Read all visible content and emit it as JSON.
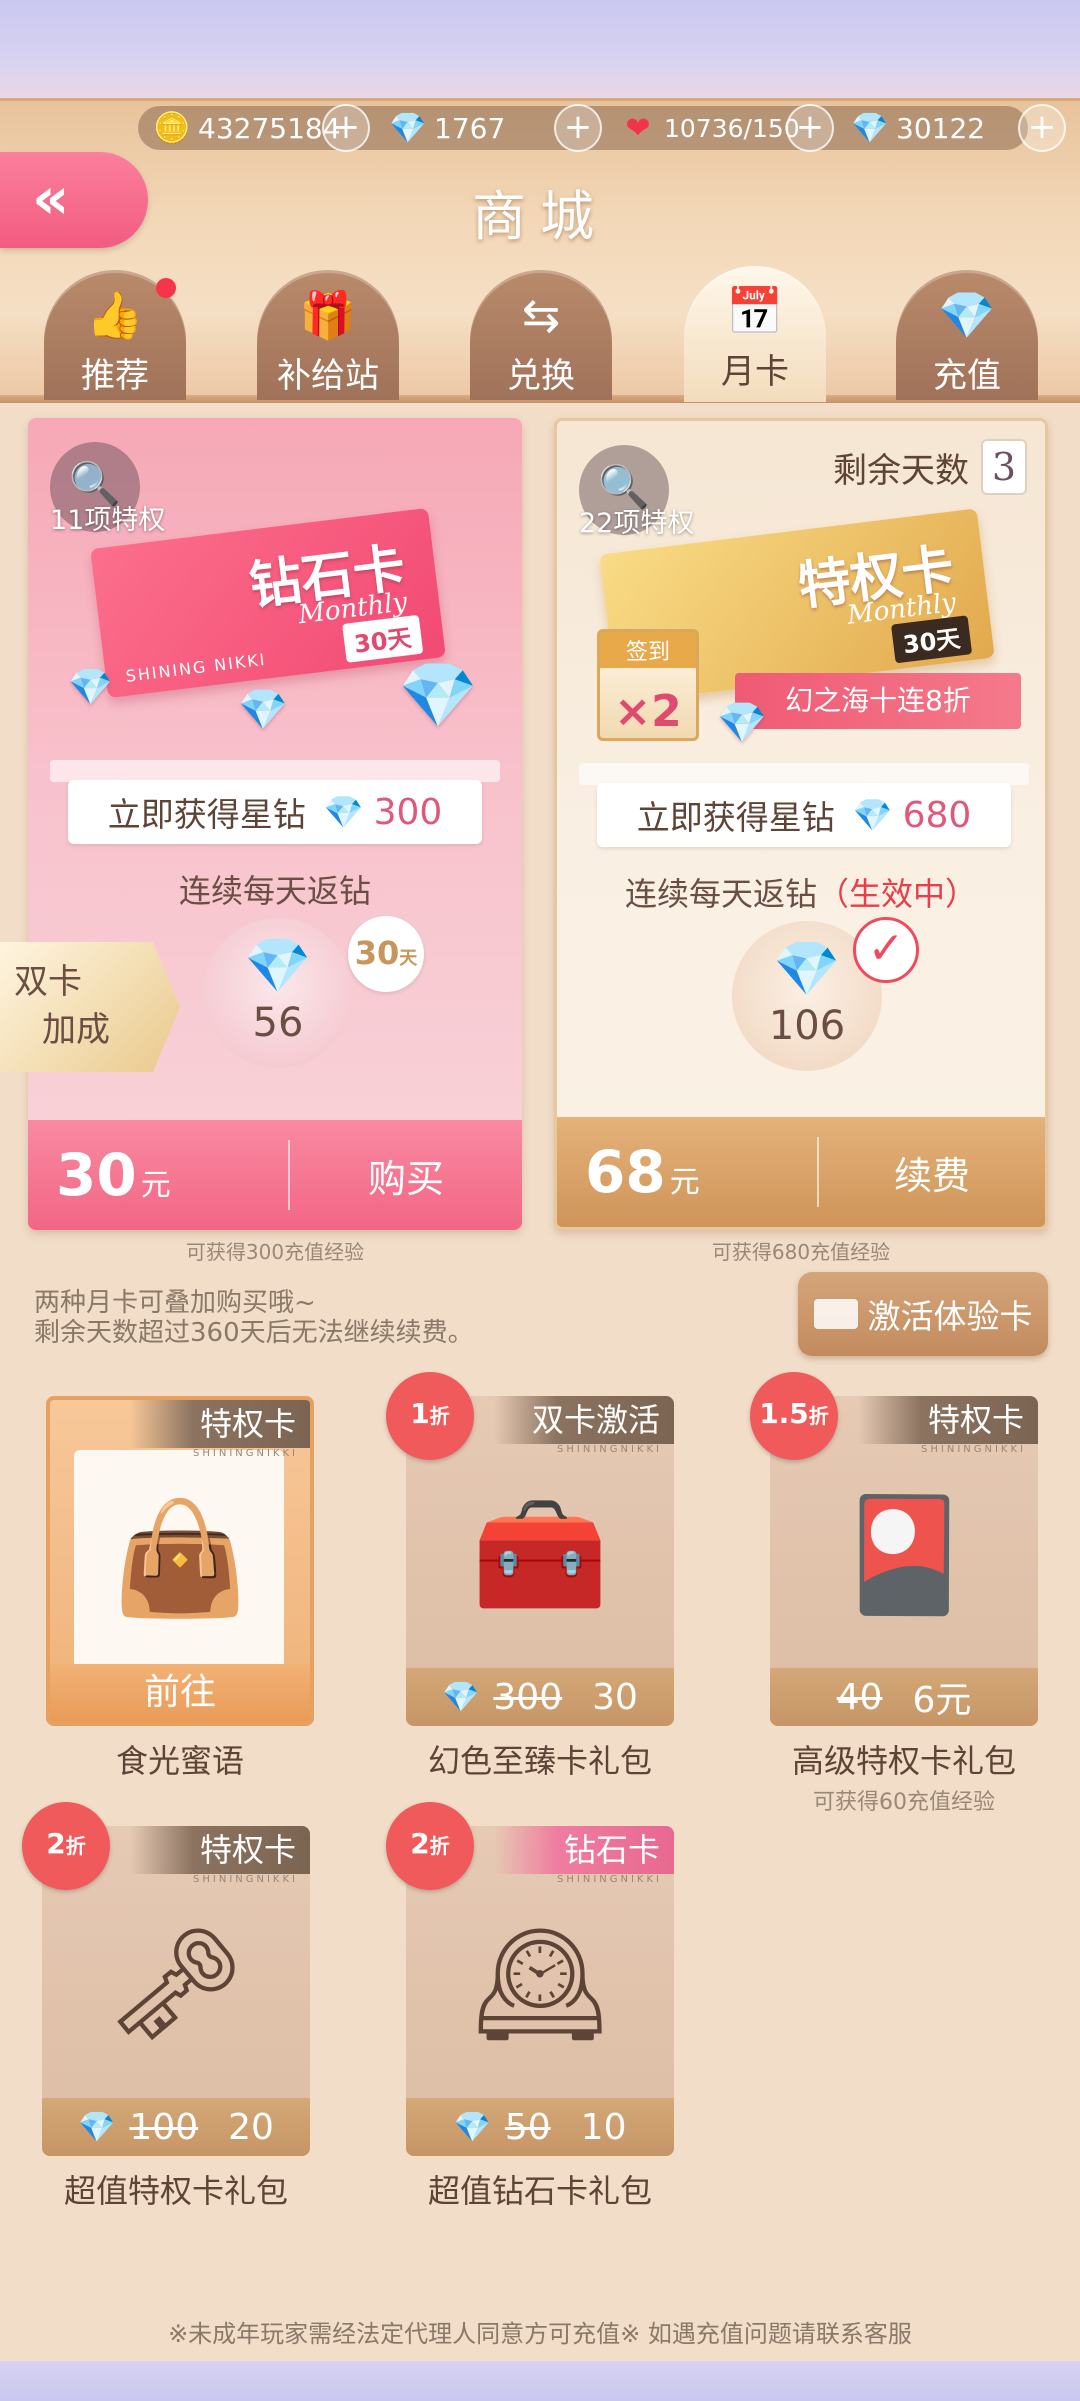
{
  "currencies": [
    {
      "icon": "coin-icon",
      "glyph": "🪙",
      "value": "43275184"
    },
    {
      "icon": "diamond-icon",
      "glyph": "💎",
      "value": "1767"
    },
    {
      "icon": "heart-icon",
      "glyph": "❤",
      "value": "10736/150"
    },
    {
      "icon": "star-diamond-icon",
      "glyph": "💎",
      "value": "30122"
    }
  ],
  "plus_label": "+",
  "back_label": "«",
  "title": "商城",
  "tabs": [
    {
      "label": "推荐",
      "icon": "thumbs-up-icon",
      "glyph": "👍"
    },
    {
      "label": "补给站",
      "icon": "supply-icon",
      "glyph": "🎁"
    },
    {
      "label": "兑换",
      "icon": "exchange-icon",
      "glyph": "⇆"
    },
    {
      "label": "月卡",
      "icon": "calendar-icon",
      "glyph": "📅"
    },
    {
      "label": "充值",
      "icon": "diamond-icon",
      "glyph": "💎"
    }
  ],
  "cards": {
    "diamond": {
      "privileges": "11项特权",
      "ticket_name": "钻石卡",
      "ticket_sub": "Monthly",
      "ticket_days": "30天",
      "ticket_logo": "SHINING NIKKI",
      "instant_label": "立即获得星钻",
      "instant_value": "300",
      "daily_label": "连续每天返钻",
      "daily_value": "56",
      "days_bubble": "30",
      "days_bubble_unit": "天",
      "price": "30",
      "price_unit": "元",
      "action": "购买",
      "exp_note": "可获得300充值经验"
    },
    "privilege": {
      "privileges": "22项特权",
      "remaining_label": "剩余天数",
      "remaining_value": "3",
      "ticket_name": "特权卡",
      "ticket_sub": "Monthly",
      "ticket_days": "30天",
      "sign_label": "签到",
      "sign_multiplier": "×2",
      "promo": "幻之海十连8折",
      "instant_label": "立即获得星钻",
      "instant_value": "680",
      "daily_label": "连续每天返钻",
      "daily_status": "（生效中）",
      "daily_value": "106",
      "price": "68",
      "price_unit": "元",
      "action": "续费",
      "exp_note": "可获得680充值经验"
    }
  },
  "double_card_label_1": "双卡",
  "double_card_label_2": "加成",
  "tip_line1": "两种月卡可叠加购买哦~",
  "tip_line2": "剩余天数超过360天后无法继续续费。",
  "activate_label": "激活体验卡",
  "items": [
    {
      "name": "食光蜜语",
      "ribbon": "特权卡",
      "ribbon_sub": "SHININGNIKKI",
      "goto": "前往",
      "art": "👜"
    },
    {
      "name": "幻色至臻卡礼包",
      "ribbon": "双卡激活",
      "ribbon_sub": "SHININGNIKKI",
      "discount": "1",
      "discount_unit": "折",
      "old_price": "300",
      "new_price": "30",
      "art": "🧰"
    },
    {
      "name": "高级特权卡礼包",
      "ribbon": "特权卡",
      "ribbon_sub": "SHININGNIKKI",
      "discount": "1.5",
      "discount_unit": "折",
      "old_price": "40",
      "new_price": "6元",
      "exp": "可获得60充值经验",
      "art": "🎴"
    },
    {
      "name": "超值特权卡礼包",
      "ribbon": "特权卡",
      "ribbon_sub": "SHININGNIKKI",
      "discount": "2",
      "discount_unit": "折",
      "old_price": "100",
      "new_price": "20",
      "art": "🗝"
    },
    {
      "name": "超值钻石卡礼包",
      "ribbon": "钻石卡",
      "ribbon_sub": "SHININGNIKKI",
      "discount": "2",
      "discount_unit": "折",
      "old_price": "50",
      "new_price": "10",
      "art": "🕰"
    }
  ],
  "footer": "※未成年玩家需经法定代理人同意方可充值※ 如遇充值问题请联系客服",
  "colors": {
    "accent_pink": "#f26685",
    "accent_gold": "#cf9458",
    "active_red": "#e83d4a"
  }
}
